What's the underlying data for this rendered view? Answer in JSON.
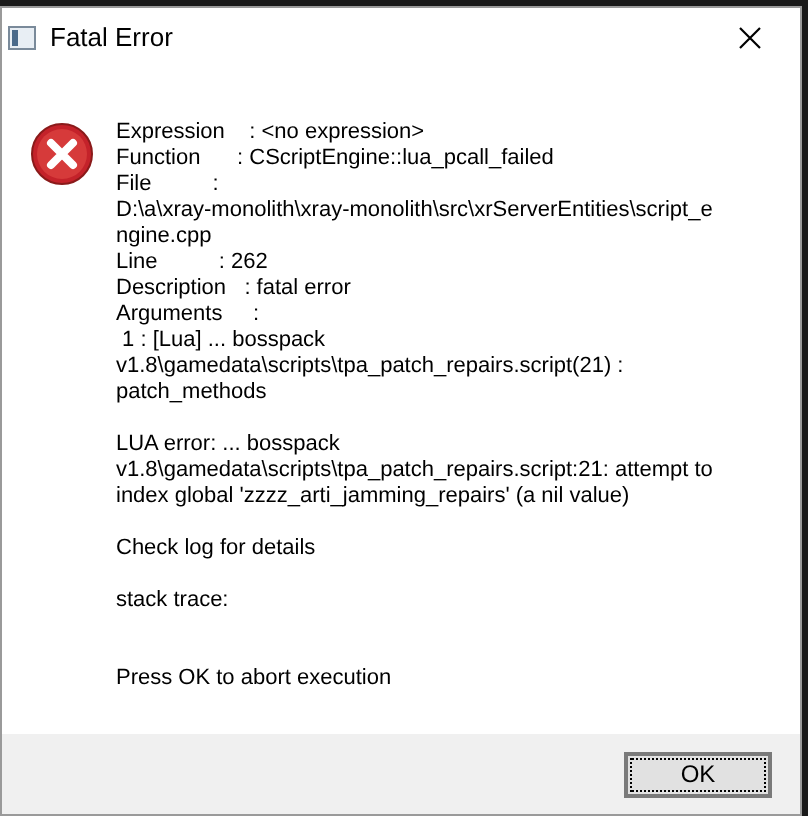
{
  "window": {
    "title": "Fatal Error"
  },
  "message": {
    "paragraphs": [
      [
        "Expression    : <no expression>",
        "Function      : CScriptEngine::lua_pcall_failed",
        "File          :",
        "D:\\a\\xray-monolith\\xray-monolith\\src\\xrServerEntities\\script_e",
        "ngine.cpp",
        "Line          : 262",
        "Description   : fatal error",
        "Arguments     :",
        " 1 : [Lua] ... bosspack",
        "v1.8\\gamedata\\scripts\\tpa_patch_repairs.script(21) :",
        "patch_methods"
      ],
      [
        "LUA error: ... bosspack",
        "v1.8\\gamedata\\scripts\\tpa_patch_repairs.script:21: attempt to",
        "index global 'zzzz_arti_jamming_repairs' (a nil value)"
      ],
      [
        "Check log for details"
      ],
      [
        "stack trace:"
      ],
      [
        "Press OK to abort execution"
      ]
    ]
  },
  "buttons": [
    "OK"
  ]
}
